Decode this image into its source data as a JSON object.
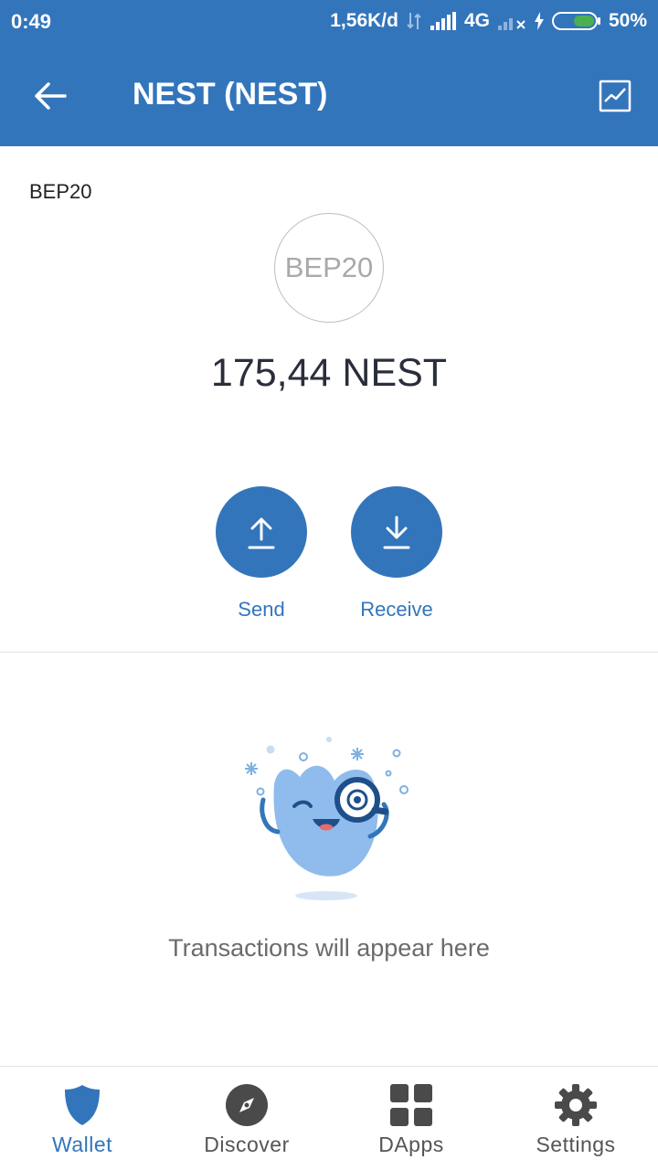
{
  "status_bar": {
    "time": "0:49",
    "network_speed": "1,56K/d",
    "network_type": "4G",
    "battery": "50%"
  },
  "app_bar": {
    "title": "NEST (NEST)",
    "back_icon": "arrow-left-icon",
    "chart_icon": "chart-icon"
  },
  "token": {
    "network": "BEP20",
    "logo_text": "BEP20",
    "balance": "175,44 NEST"
  },
  "actions": {
    "send_label": "Send",
    "receive_label": "Receive"
  },
  "transactions": {
    "empty_message": "Transactions will appear here"
  },
  "tabs": [
    {
      "label": "Wallet",
      "icon": "shield-icon",
      "active": true
    },
    {
      "label": "Discover",
      "icon": "compass-icon",
      "active": false
    },
    {
      "label": "DApps",
      "icon": "grid-icon",
      "active": false
    },
    {
      "label": "Settings",
      "icon": "gear-icon",
      "active": false
    }
  ],
  "colors": {
    "brand": "#3375bb",
    "text_dark": "#2a2e3b",
    "text_muted": "#6b6b6b"
  }
}
